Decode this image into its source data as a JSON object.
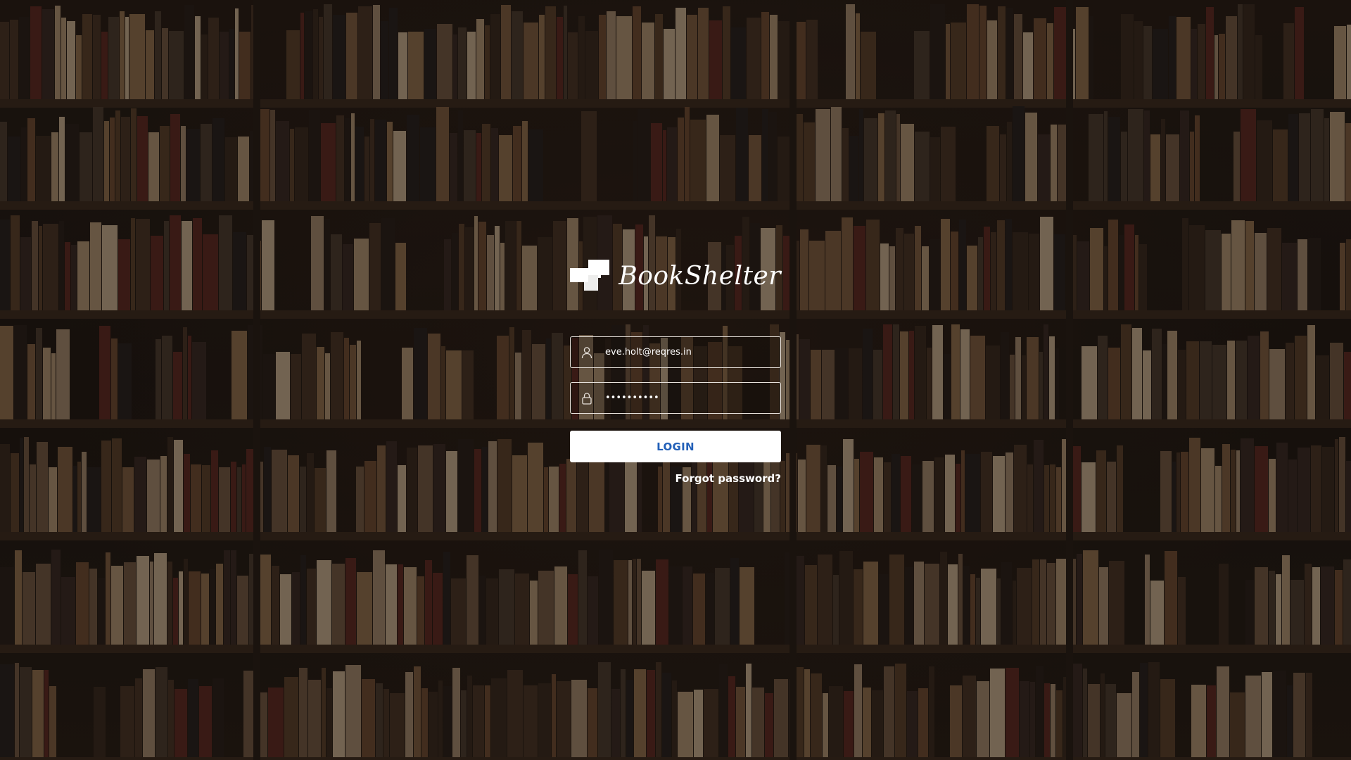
{
  "app": {
    "brand_name": "BookShelter",
    "background": "bookshelf-photo"
  },
  "login_form": {
    "email": {
      "icon": "user-icon",
      "value": "eve.holt@reqres.in",
      "placeholder": ""
    },
    "password": {
      "icon": "lock-icon",
      "value": "cityslicka",
      "placeholder": ""
    },
    "login_label": "LOGIN",
    "forgot_label": "Forgot password?"
  },
  "colors": {
    "login_text": "#2360b8",
    "button_bg": "#ffffff",
    "field_border": "#e8e2dc"
  }
}
